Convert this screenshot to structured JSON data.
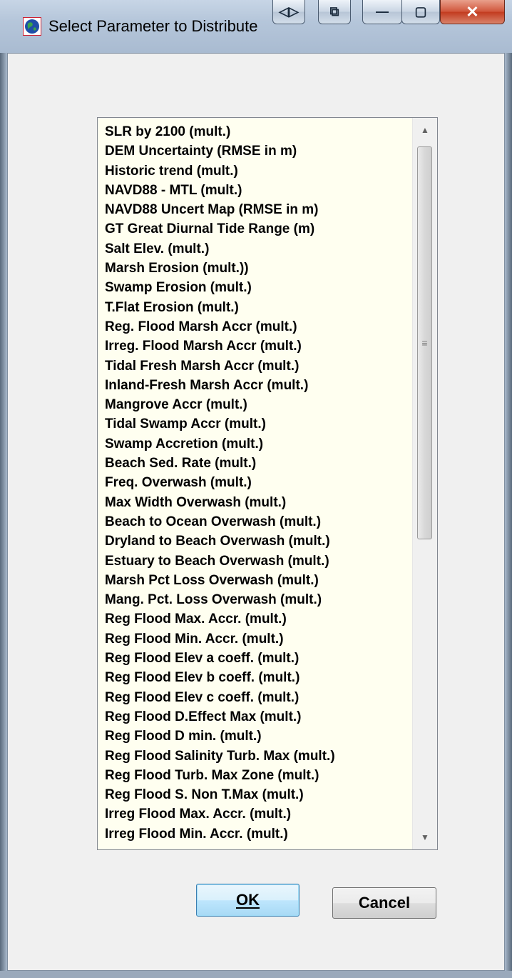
{
  "window": {
    "title": "Select Parameter to Distribute",
    "icon": "globe-icon",
    "caption_buttons": [
      "restore-arrows-icon",
      "copy-icon",
      "minimize-icon",
      "maximize-icon",
      "close-icon"
    ]
  },
  "list": {
    "items": [
      "SLR by 2100 (mult.)",
      "DEM Uncertainty (RMSE in m)",
      "Historic trend (mult.)",
      "NAVD88 - MTL (mult.)",
      "NAVD88 Uncert Map (RMSE in m)",
      "GT Great Diurnal Tide Range (m)",
      "Salt Elev. (mult.)",
      "Marsh Erosion (mult.))",
      "Swamp Erosion (mult.)",
      "T.Flat Erosion (mult.)",
      "Reg. Flood Marsh Accr (mult.)",
      "Irreg. Flood Marsh Accr (mult.)",
      "Tidal Fresh Marsh Accr (mult.)",
      "Inland-Fresh Marsh Accr (mult.)",
      "Mangrove Accr (mult.)",
      "Tidal Swamp Accr (mult.)",
      "Swamp Accretion (mult.)",
      "Beach Sed. Rate (mult.)",
      "Freq. Overwash (mult.)",
      "Max Width Overwash (mult.)",
      "Beach to Ocean Overwash (mult.)",
      "Dryland to Beach Overwash (mult.)",
      "Estuary to Beach Overwash (mult.)",
      "Marsh Pct Loss Overwash (mult.)",
      "Mang. Pct. Loss Overwash (mult.)",
      "Reg Flood Max. Accr. (mult.)",
      "Reg Flood Min. Accr. (mult.)",
      "Reg Flood Elev a coeff. (mult.)",
      "Reg Flood Elev b coeff. (mult.)",
      "Reg Flood Elev c coeff. (mult.)",
      "Reg Flood D.Effect Max (mult.)",
      "Reg Flood D min. (mult.)",
      "Reg Flood Salinity Turb. Max (mult.)",
      "Reg Flood Turb. Max Zone (mult.)",
      "Reg Flood S. Non T.Max (mult.)",
      "Irreg Flood Max. Accr. (mult.)",
      "Irreg Flood Min. Accr. (mult.)"
    ]
  },
  "buttons": {
    "ok": "OK",
    "cancel": "Cancel"
  }
}
